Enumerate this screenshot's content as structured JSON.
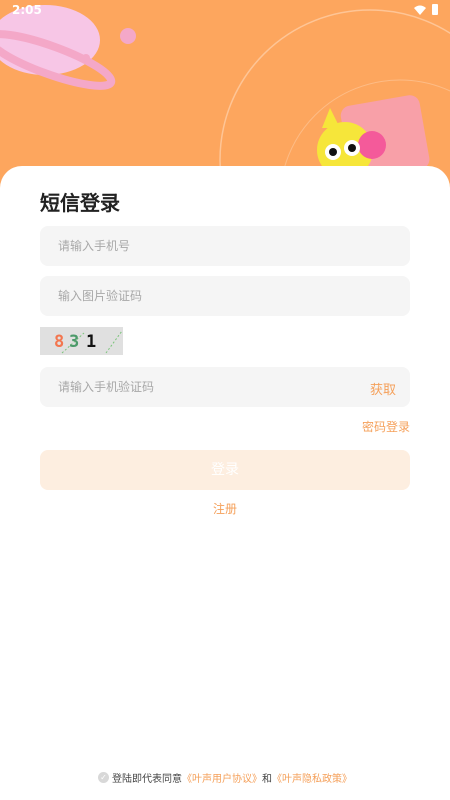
{
  "status_bar": {
    "time": "2:05"
  },
  "login": {
    "title": "短信登录",
    "phone_placeholder": "请输入手机号",
    "image_code_placeholder": "输入图片验证码",
    "captcha_chars": [
      "8",
      "3",
      "1"
    ],
    "sms_code_placeholder": "请输入手机验证码",
    "get_code_label": "获取",
    "password_login_label": "密码登录",
    "login_button_label": "登录",
    "register_label": "注册"
  },
  "agreement": {
    "prefix": "登陆即代表同意",
    "user_agreement": "《叶声用户协议》",
    "conjunction": "和",
    "privacy_policy": "《叶声隐私政策》"
  },
  "colors": {
    "header": "#fda65e",
    "accent": "#f5a05a",
    "input_bg": "#f5f5f5"
  },
  "icons": [
    "wifi-icon",
    "battery-icon",
    "checkbox-icon"
  ]
}
